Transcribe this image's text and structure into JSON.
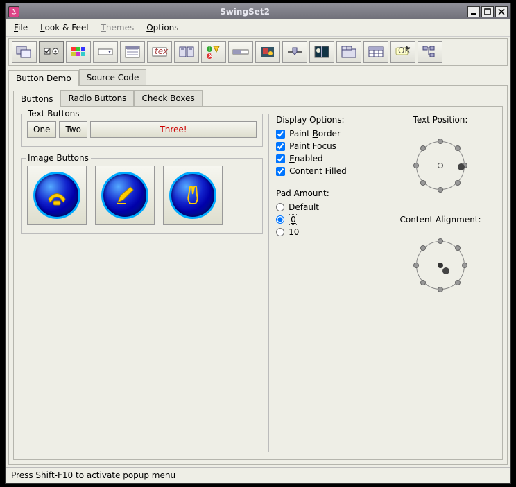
{
  "window": {
    "title": "SwingSet2"
  },
  "menus": {
    "file": "File",
    "lookfeel": "Look & Feel",
    "themes": "Themes",
    "options": "Options"
  },
  "primaryTabs": {
    "buttonDemo": "Button Demo",
    "sourceCode": "Source Code"
  },
  "subTabs": {
    "buttons": "Buttons",
    "radioButtons": "Radio Buttons",
    "checkBoxes": "Check Boxes"
  },
  "textButtons": {
    "legend": "Text Buttons",
    "one": "One",
    "two": "Two",
    "three": "Three!"
  },
  "imageButtons": {
    "legend": "Image Buttons",
    "icons": [
      "phone-icon",
      "pen-icon",
      "peace-icon"
    ]
  },
  "displayOptions": {
    "label": "Display Options:",
    "paintBorder": "Paint Border",
    "paintFocus": "Paint Focus",
    "enabled": "Enabled",
    "contentFilled": "Content Filled"
  },
  "padAmount": {
    "label": "Pad Amount:",
    "default": "Default",
    "zero": "0",
    "ten": "10",
    "selected": "0"
  },
  "positionDials": {
    "textPosition": "Text Position:",
    "contentAlignment": "Content Alignment:"
  },
  "statusbar": "Press Shift-F10 to activate popup menu",
  "toolbarIcons": [
    "frames-icon",
    "checkbox-radio-icon",
    "colorchooser-icon",
    "combobox-icon",
    "list-icon",
    "text-icon",
    "filechooser-icon",
    "optionpane-icon",
    "progressbar-icon",
    "scrollpane-icon",
    "slider-icon",
    "splitpane-icon",
    "tabbedpane-icon",
    "table-icon",
    "tooltip-icon",
    "tree-icon"
  ]
}
